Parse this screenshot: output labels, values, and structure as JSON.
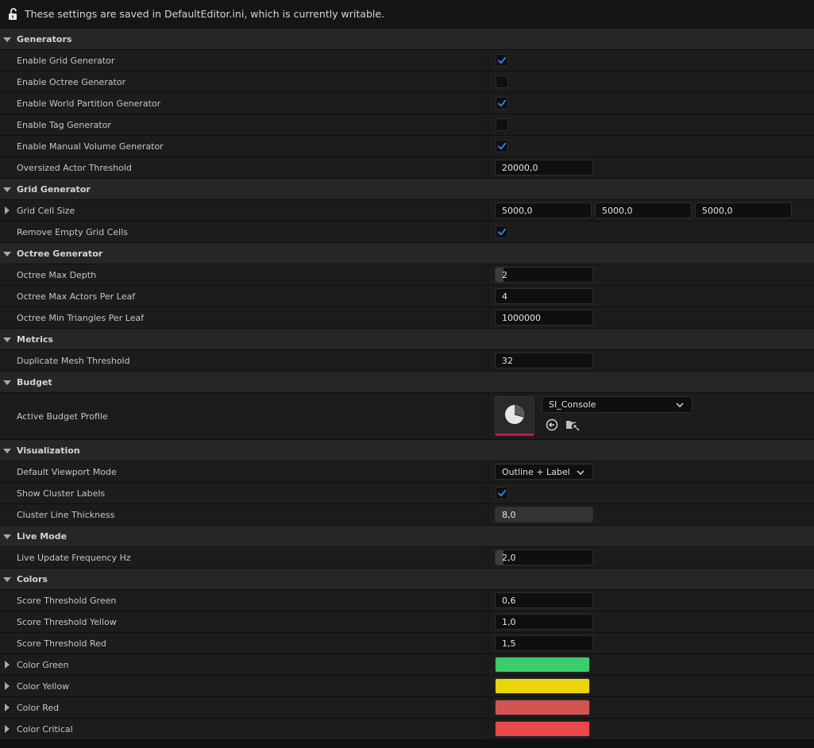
{
  "notice": {
    "text": "These settings are saved in DefaultEditor.ini, which is currently writable.",
    "icon": "unlocked-icon"
  },
  "rows": [
    {
      "kind": "section",
      "label": "Generators"
    },
    {
      "kind": "check",
      "label": "Enable Grid Generator",
      "checked": true
    },
    {
      "kind": "check",
      "label": "Enable Octree Generator",
      "checked": false
    },
    {
      "kind": "check",
      "label": "Enable World Partition Generator",
      "checked": true
    },
    {
      "kind": "check",
      "label": "Enable Tag Generator",
      "checked": false
    },
    {
      "kind": "check",
      "label": "Enable Manual Volume Generator",
      "checked": true
    },
    {
      "kind": "number",
      "label": "Oversized Actor Threshold",
      "value": "20000,0"
    },
    {
      "kind": "section",
      "label": "Grid Generator"
    },
    {
      "kind": "vector",
      "label": "Grid Cell Size",
      "expandable": true,
      "values": [
        "5000,0",
        "5000,0",
        "5000,0"
      ]
    },
    {
      "kind": "check",
      "label": "Remove Empty Grid Cells",
      "checked": true
    },
    {
      "kind": "section",
      "label": "Octree Generator"
    },
    {
      "kind": "number",
      "label": "Octree Max Depth",
      "value": "2",
      "spin": true
    },
    {
      "kind": "number",
      "label": "Octree Max Actors Per Leaf",
      "value": "4"
    },
    {
      "kind": "number",
      "label": "Octree Min Triangles Per Leaf",
      "value": "1000000"
    },
    {
      "kind": "section",
      "label": "Metrics"
    },
    {
      "kind": "number",
      "label": "Duplicate Mesh Threshold",
      "value": "32"
    },
    {
      "kind": "section",
      "label": "Budget"
    },
    {
      "kind": "asset",
      "label": "Active Budget Profile",
      "value": "SI_Console"
    },
    {
      "kind": "section",
      "label": "Visualization"
    },
    {
      "kind": "dropdown",
      "label": "Default Viewport Mode",
      "value": "Outline + Label"
    },
    {
      "kind": "check",
      "label": "Show Cluster Labels",
      "checked": true
    },
    {
      "kind": "number",
      "label": "Cluster Line Thickness",
      "value": "8,0",
      "slider": true
    },
    {
      "kind": "section",
      "label": "Live Mode"
    },
    {
      "kind": "number",
      "label": "Live Update Frequency Hz",
      "value": "2,0",
      "spin": true
    },
    {
      "kind": "section",
      "label": "Colors"
    },
    {
      "kind": "number",
      "label": "Score Threshold Green",
      "value": "0,6"
    },
    {
      "kind": "number",
      "label": "Score Threshold Yellow",
      "value": "1,0"
    },
    {
      "kind": "number",
      "label": "Score Threshold Red",
      "value": "1,5"
    },
    {
      "kind": "color",
      "label": "Color Green",
      "expandable": true,
      "color": "#3dcc6b"
    },
    {
      "kind": "color",
      "label": "Color Yellow",
      "expandable": true,
      "color": "#ead40a"
    },
    {
      "kind": "color",
      "label": "Color Red",
      "expandable": true,
      "color": "#d35452"
    },
    {
      "kind": "color",
      "label": "Color Critical",
      "expandable": true,
      "color": "#e8484a"
    }
  ],
  "colors": {
    "checkmark": "#2f7fe0",
    "asset_underline": "#c2185b"
  }
}
